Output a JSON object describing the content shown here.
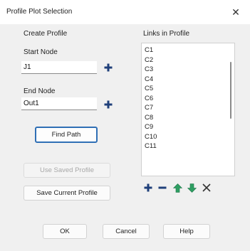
{
  "window": {
    "title": "Profile Plot Selection",
    "close_symbol": "✕"
  },
  "create_profile": {
    "heading": "Create Profile",
    "start_node_label": "Start Node",
    "start_node_value": "J1",
    "end_node_label": "End Node",
    "end_node_value": "Out1",
    "find_path_label": "Find Path",
    "use_saved_profile_label": "Use Saved Profile",
    "save_current_profile_label": "Save Current Profile"
  },
  "links": {
    "heading": "Links in Profile",
    "items": [
      "C1",
      "C2",
      "C3",
      "C4",
      "C5",
      "C6",
      "C7",
      "C8",
      "C9",
      "C10",
      "C11"
    ],
    "toolbar": [
      "plus-icon",
      "minus-icon",
      "arrow-up-icon",
      "arrow-down-icon",
      "delete-x-icon"
    ]
  },
  "footer": {
    "ok_label": "OK",
    "cancel_label": "Cancel",
    "help_label": "Help"
  },
  "colors": {
    "icon_blue": "#1f3f7a",
    "icon_green": "#2e9e62",
    "default_border": "#2f6fb5"
  }
}
